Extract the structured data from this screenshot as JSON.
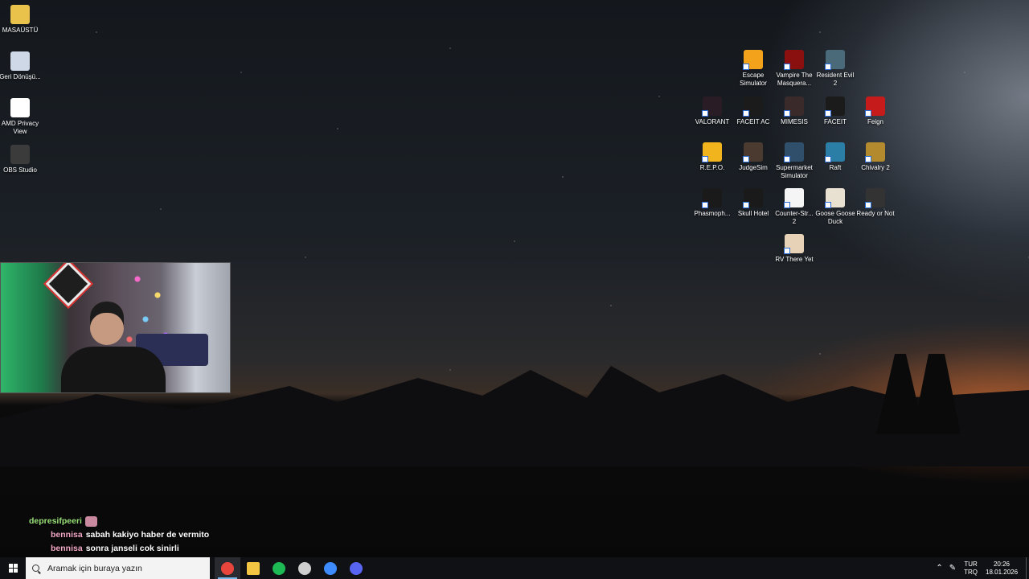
{
  "desktop_left": [
    {
      "label": "MASAÜSTÜ",
      "icon": "folder-icon",
      "color": "#e8c24a"
    },
    {
      "label": "Geri Dönüşü...",
      "icon": "recycle-bin-icon",
      "color": "#cfd8e6"
    },
    {
      "label": "AMD Privacy View",
      "icon": "eye-icon",
      "color": "#ffffff"
    },
    {
      "label": "OBS Studio",
      "icon": "obs-icon",
      "color": "#3b3b3b"
    }
  ],
  "desktop_right": [
    {
      "label": "Escape Simulator",
      "icon": "keyhole-icon",
      "color": "#f2a31b"
    },
    {
      "label": "Vampire The Masquera...",
      "icon": "bloodhunt-icon",
      "color": "#8a1010"
    },
    {
      "label": "Resident Evil 2",
      "icon": "re2-icon",
      "color": "#4a6a7a"
    },
    {
      "label": "VALORANT",
      "icon": "valorant-icon",
      "color": "#2a1c24"
    },
    {
      "label": "FACEIT AC",
      "icon": "faceit-ac-icon",
      "color": "#1b1b1b"
    },
    {
      "label": "MIMESIS",
      "icon": "mimesis-icon",
      "color": "#3a2a2a"
    },
    {
      "label": "FACEIT",
      "icon": "faceit-icon",
      "color": "#1b1b1b"
    },
    {
      "label": "Feign",
      "icon": "feign-icon",
      "color": "#c51b1b"
    },
    {
      "label": "R.E.P.O.",
      "icon": "repo-icon",
      "color": "#f1b41c"
    },
    {
      "label": "JudgeSim",
      "icon": "judgesim-icon",
      "color": "#4a3a30"
    },
    {
      "label": "Supermarket Simulator",
      "icon": "supermarket-icon",
      "color": "#2f4f6a"
    },
    {
      "label": "Raft",
      "icon": "raft-icon",
      "color": "#2b7ea6"
    },
    {
      "label": "Chivalry 2",
      "icon": "chivalry-icon",
      "color": "#b38b2e"
    },
    {
      "label": "Phasmoph...",
      "icon": "phasmophobia-icon",
      "color": "#1a1a1a"
    },
    {
      "label": "Skull Hotel",
      "icon": "skull-icon",
      "color": "#1a1a1a"
    },
    {
      "label": "Counter-Str... 2",
      "icon": "cs2-icon",
      "color": "#f5f5f5"
    },
    {
      "label": "Goose Goose Duck",
      "icon": "goose-icon",
      "color": "#e8e0d0"
    },
    {
      "label": "Ready or Not",
      "icon": "readyornot-icon",
      "color": "#333333"
    },
    {
      "label": "RV There Yet",
      "icon": "rv-icon",
      "color": "#e7d2b8"
    }
  ],
  "chat": [
    {
      "user": "depresifpeeri",
      "message": "",
      "emote": true
    },
    {
      "user": "bennisa",
      "message": "sabah kakiyo haber de vermito",
      "emote": false
    },
    {
      "user": "bennisa",
      "message": "sonra janseli cok sinirli",
      "emote": false
    }
  ],
  "taskbar": {
    "search_placeholder": "Aramak için buraya yazın",
    "apps": [
      {
        "name": "chrome-icon",
        "color": "#e8453c",
        "active": true
      },
      {
        "name": "file-explorer-icon",
        "color": "#f4c542",
        "active": false
      },
      {
        "name": "spotify-icon",
        "color": "#1db954",
        "active": false
      },
      {
        "name": "obs-icon",
        "color": "#cfcfcf",
        "active": false
      },
      {
        "name": "app-icon",
        "color": "#3d8bfd",
        "active": false
      },
      {
        "name": "discord-icon",
        "color": "#5865f2",
        "active": false
      }
    ],
    "lang_line1": "TUR",
    "lang_line2": "TRQ",
    "time": "20:26",
    "date": "18.01.2026"
  }
}
